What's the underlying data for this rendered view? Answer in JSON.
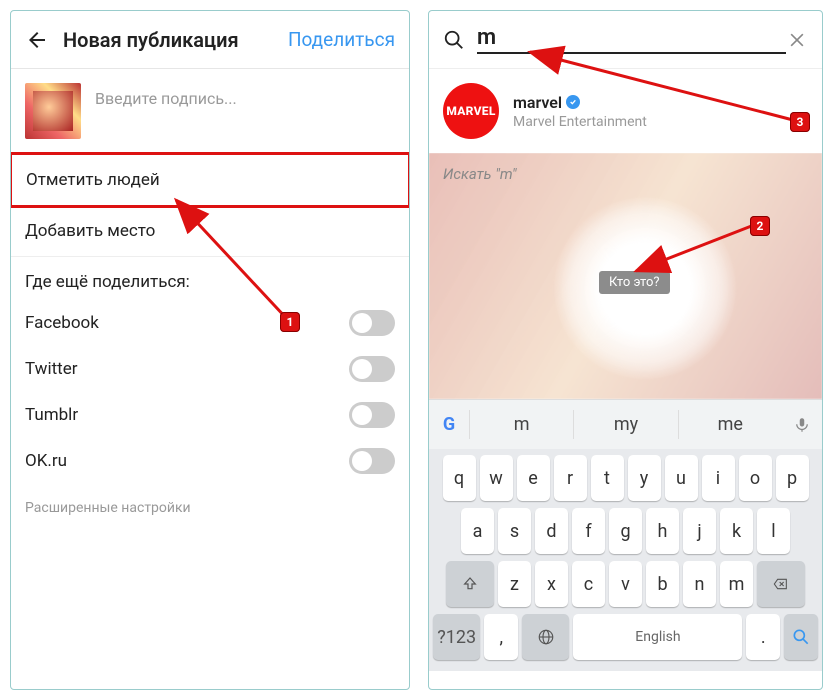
{
  "left": {
    "header": {
      "title": "Новая публикация",
      "share": "Поделиться"
    },
    "caption_placeholder": "Введите подпись...",
    "tag_people": "Отметить людей",
    "add_location": "Добавить место",
    "share_elsewhere": "Где ещё поделиться:",
    "networks": [
      "Facebook",
      "Twitter",
      "Tumblr",
      "OK.ru"
    ],
    "advanced": "Расширенные настройки"
  },
  "right": {
    "search_value": "m",
    "result": {
      "logo_text": "MARVEL",
      "username": "marvel",
      "subtitle": "Marvel Entertainment"
    },
    "search_label_prefix": "Искать \"",
    "search_label_suffix": "\"",
    "who_is_this": "Кто это?",
    "suggestions": [
      "m",
      "my",
      "me"
    ],
    "keyboard": {
      "row1": [
        "q",
        "w",
        "e",
        "r",
        "t",
        "y",
        "u",
        "i",
        "o",
        "p"
      ],
      "row2": [
        "a",
        "s",
        "d",
        "f",
        "g",
        "h",
        "j",
        "k",
        "l"
      ],
      "row3": [
        "z",
        "x",
        "c",
        "v",
        "b",
        "n",
        "m"
      ],
      "sym": "?123",
      "lang": "English"
    }
  },
  "badges": [
    "1",
    "2",
    "3"
  ]
}
